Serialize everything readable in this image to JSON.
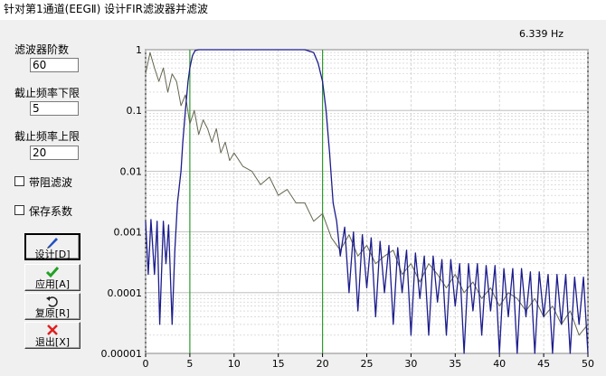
{
  "window": {
    "title": "针对第1通道(EEGⅡ) 设计FIR滤波器并滤波"
  },
  "params": {
    "order_label": "滤波器阶数",
    "order_value": "60",
    "low_cut_label": "截止频率下限",
    "low_cut_value": "5",
    "high_cut_label": "截止频率上限",
    "high_cut_value": "20"
  },
  "options": {
    "bandstop_label": "带阻滤波",
    "save_coeffs_label": "保存系数"
  },
  "buttons": {
    "design_label": "设计[D]",
    "apply_label": "应用[A]",
    "restore_label": "复原[R]",
    "exit_label": "退出[X]"
  },
  "colors": {
    "response": "#1c1c8c",
    "spectrum": "#666650",
    "cutoff_lines": "#2e9a2e",
    "apply_icon": "#22a022",
    "exit_icon": "#e02020",
    "design_icon": "#2050c0"
  },
  "icons": {
    "design": "pencil-icon",
    "apply": "checkmark-icon",
    "restore": "undo-arrow-icon",
    "exit": "red-x-icon"
  },
  "chart_data": {
    "type": "line",
    "title": "6.339 Hz",
    "xlabel": "",
    "ylabel": "",
    "xlim": [
      0,
      50
    ],
    "ylim": [
      1e-05,
      1
    ],
    "y_scale": "log",
    "x_ticks": [
      0,
      5,
      10,
      15,
      20,
      25,
      30,
      35,
      40,
      45,
      50
    ],
    "y_ticks": [
      "1",
      "0.1",
      "0.01",
      "0.001",
      "0.0001",
      "0.00001"
    ],
    "grid": true,
    "cutoff_markers": [
      5,
      20
    ],
    "series": [
      {
        "id": "filter_response",
        "x": [
          0,
          0.3,
          0.6,
          1,
          1.3,
          1.6,
          2,
          2.3,
          2.6,
          3,
          3.3,
          3.6,
          4,
          4.2,
          4.5,
          4.8,
          5,
          5.3,
          5.6,
          6,
          7,
          10,
          14,
          18,
          19,
          19.5,
          20,
          20.4,
          20.8,
          21.2,
          21.6,
          22,
          22.5,
          23,
          23.5,
          24,
          24.5,
          25,
          25.5,
          26,
          26.5,
          27,
          27.5,
          28,
          28.5,
          29,
          29.5,
          30,
          30.5,
          31,
          31.5,
          32,
          32.5,
          33,
          33.5,
          34,
          34.5,
          35,
          35.5,
          36,
          36.5,
          37,
          37.5,
          38,
          38.5,
          39,
          39.5,
          40,
          40.5,
          41,
          41.5,
          42,
          42.5,
          43,
          43.5,
          44,
          44.5,
          45,
          45.5,
          46,
          46.5,
          47,
          47.5,
          48,
          48.5,
          49,
          49.5,
          50
        ],
        "y": [
          0.0015,
          0.0002,
          0.0016,
          0.0002,
          0.0015,
          3e-05,
          0.0015,
          0.0003,
          0.0013,
          3e-05,
          0.0005,
          0.003,
          0.01,
          0.03,
          0.1,
          0.3,
          0.5,
          0.8,
          0.97,
          1,
          1,
          1,
          1,
          1,
          0.9,
          0.6,
          0.3,
          0.1,
          0.02,
          0.003,
          0.0015,
          0.0004,
          0.0012,
          0.0001,
          0.001,
          5e-05,
          0.0009,
          0.00012,
          0.0008,
          4e-05,
          0.0007,
          0.0001,
          0.0006,
          3e-05,
          0.00055,
          0.0001,
          0.0005,
          2e-05,
          0.00045,
          8e-05,
          0.0004,
          2e-05,
          0.0004,
          7e-05,
          0.00035,
          2e-05,
          0.00035,
          6e-05,
          0.0003,
          1e-05,
          0.0003,
          5e-05,
          0.0003,
          2e-05,
          0.00028,
          5e-05,
          0.00028,
          1e-05,
          0.00025,
          4e-05,
          0.00025,
          1e-05,
          0.00025,
          4e-05,
          0.00022,
          1e-05,
          0.00022,
          4e-05,
          0.0002,
          1e-05,
          0.0002,
          3e-05,
          0.0002,
          1e-05,
          0.00018,
          3e-05,
          0.00018,
          1e-05
        ]
      },
      {
        "id": "signal_spectrum",
        "x": [
          0,
          0.5,
          1,
          1.5,
          2,
          2.5,
          3,
          3.5,
          4,
          4.5,
          5,
          5.5,
          6,
          6.5,
          7,
          7.5,
          8,
          8.5,
          9,
          9.5,
          10,
          11,
          12,
          13,
          14,
          15,
          16,
          17,
          18,
          19,
          20,
          21,
          22,
          23,
          24,
          25,
          26,
          27,
          28,
          29,
          30,
          31,
          32,
          33,
          34,
          35,
          36,
          37,
          38,
          39,
          40,
          41,
          42,
          43,
          44,
          45,
          46,
          47,
          48,
          49,
          50
        ],
        "y": [
          0.4,
          0.9,
          0.5,
          0.3,
          0.5,
          0.2,
          0.4,
          0.3,
          0.12,
          0.18,
          0.06,
          0.1,
          0.04,
          0.07,
          0.05,
          0.03,
          0.05,
          0.02,
          0.03,
          0.015,
          0.02,
          0.012,
          0.01,
          0.006,
          0.008,
          0.004,
          0.005,
          0.003,
          0.003,
          0.0015,
          0.002,
          0.0008,
          0.0005,
          0.0009,
          0.0004,
          0.0006,
          0.0003,
          0.0004,
          0.0005,
          0.0002,
          0.0003,
          0.00015,
          0.0003,
          0.0002,
          0.00012,
          0.0002,
          0.0001,
          0.00015,
          8e-05,
          0.00012,
          6e-05,
          0.0001,
          8e-05,
          5e-05,
          8e-05,
          4e-05,
          6e-05,
          3e-05,
          5e-05,
          2e-05,
          3e-05
        ]
      }
    ]
  }
}
